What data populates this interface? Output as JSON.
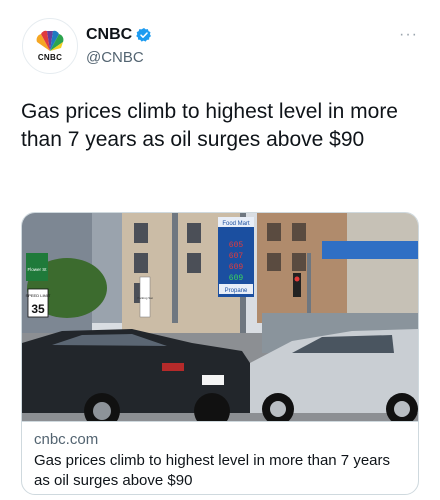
{
  "account": {
    "display_name": "CNBC",
    "handle": "@CNBC",
    "avatar_wordmark": "CNBC",
    "verified": true,
    "verified_icon": "verified-badge-icon",
    "verified_color": "#1d9bf0",
    "more_icon": "more-options-icon",
    "more_label": "···"
  },
  "tweet": {
    "text": "Gas prices climb to highest level in more than 7 years as oil surges above $90"
  },
  "card": {
    "domain": "cnbc.com",
    "title": "Gas prices climb to highest level in more than 7 years as oil surges above $90",
    "image": {
      "price_sign_header": "Food Mart",
      "prices": [
        "605",
        "607",
        "609",
        "609"
      ],
      "propane_label": "Propane",
      "speed_limit_label": "SPEED LIMIT",
      "speed_limit_value": "35",
      "street_sign_text": "Flower St",
      "parking_sign_text": "Parking Sat"
    }
  },
  "colors": {
    "text_primary": "#0f1419",
    "text_secondary": "#536471",
    "border": "#cfd9de",
    "accent": "#1d9bf0"
  }
}
